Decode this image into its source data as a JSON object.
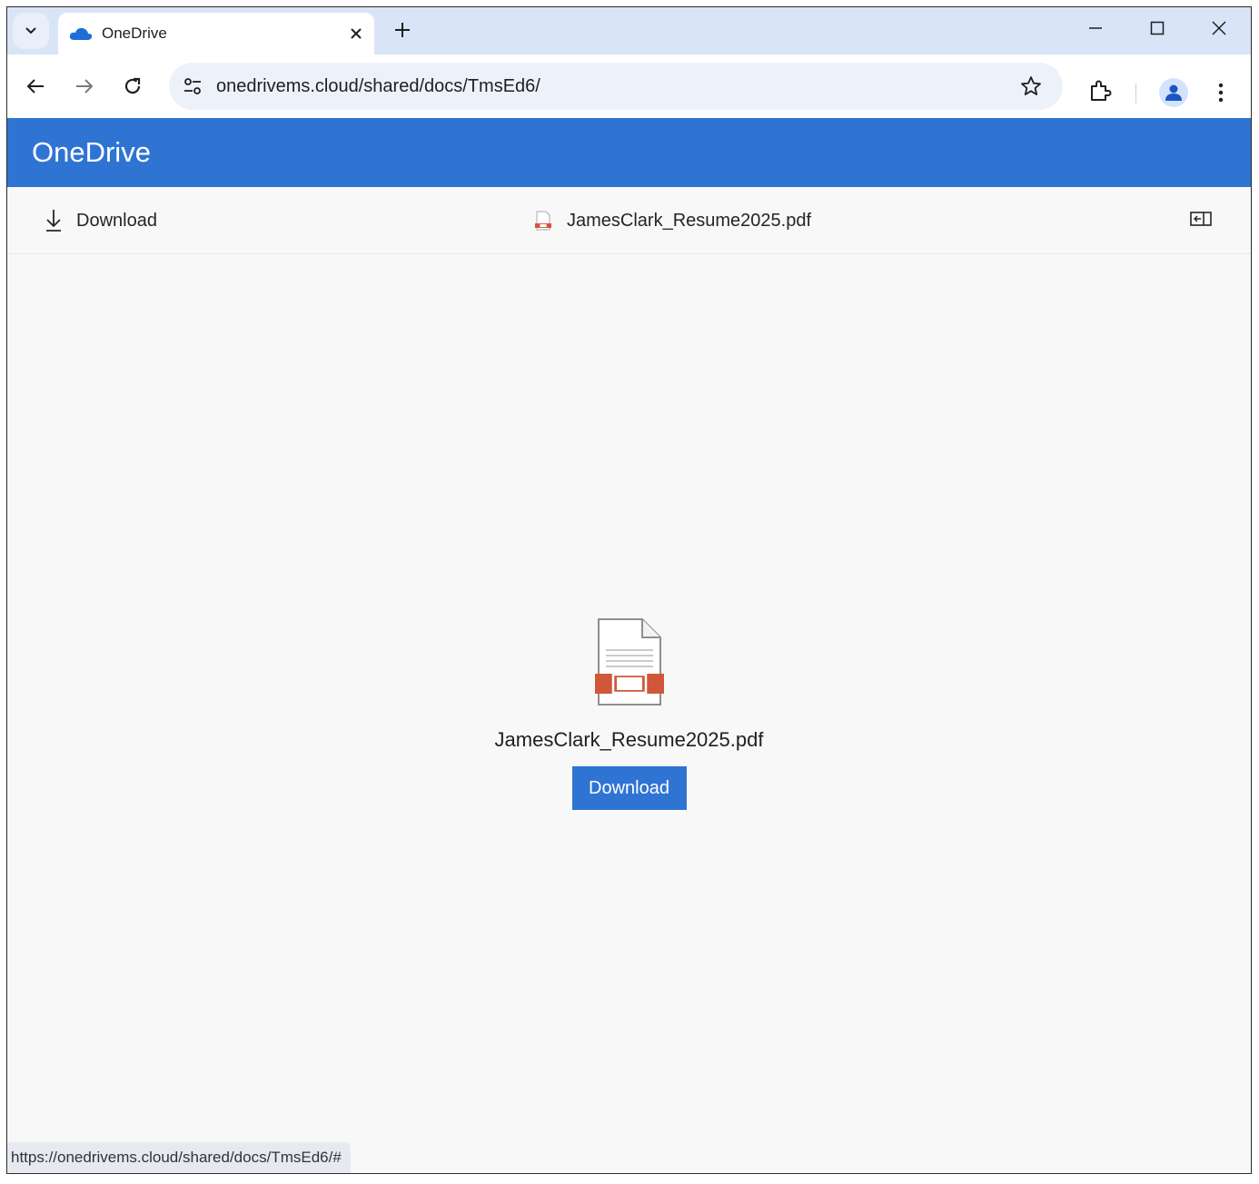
{
  "browser": {
    "tab_title": "OneDrive",
    "url": "onedrivems.cloud/shared/docs/TmsEd6/",
    "status_url": "https://onedrivems.cloud/shared/docs/TmsEd6/#"
  },
  "page": {
    "brand": "OneDrive",
    "command_bar": {
      "download_label": "Download",
      "file_name": "JamesClark_Resume2025.pdf"
    },
    "preview": {
      "file_name": "JamesClark_Resume2025.pdf",
      "download_button": "Download"
    }
  },
  "colors": {
    "brand_blue": "#2f74d2",
    "pdf_red": "#d0573a"
  },
  "icons": [
    "tab-search-icon",
    "onedrive-cloud-icon",
    "close-icon",
    "plus-icon",
    "minimize-icon",
    "maximize-icon",
    "window-close-icon",
    "back-icon",
    "forward-icon",
    "reload-icon",
    "site-settings-icon",
    "star-icon",
    "extensions-icon",
    "profile-icon",
    "more-icon",
    "download-icon",
    "pdf-file-icon",
    "panel-icon"
  ]
}
